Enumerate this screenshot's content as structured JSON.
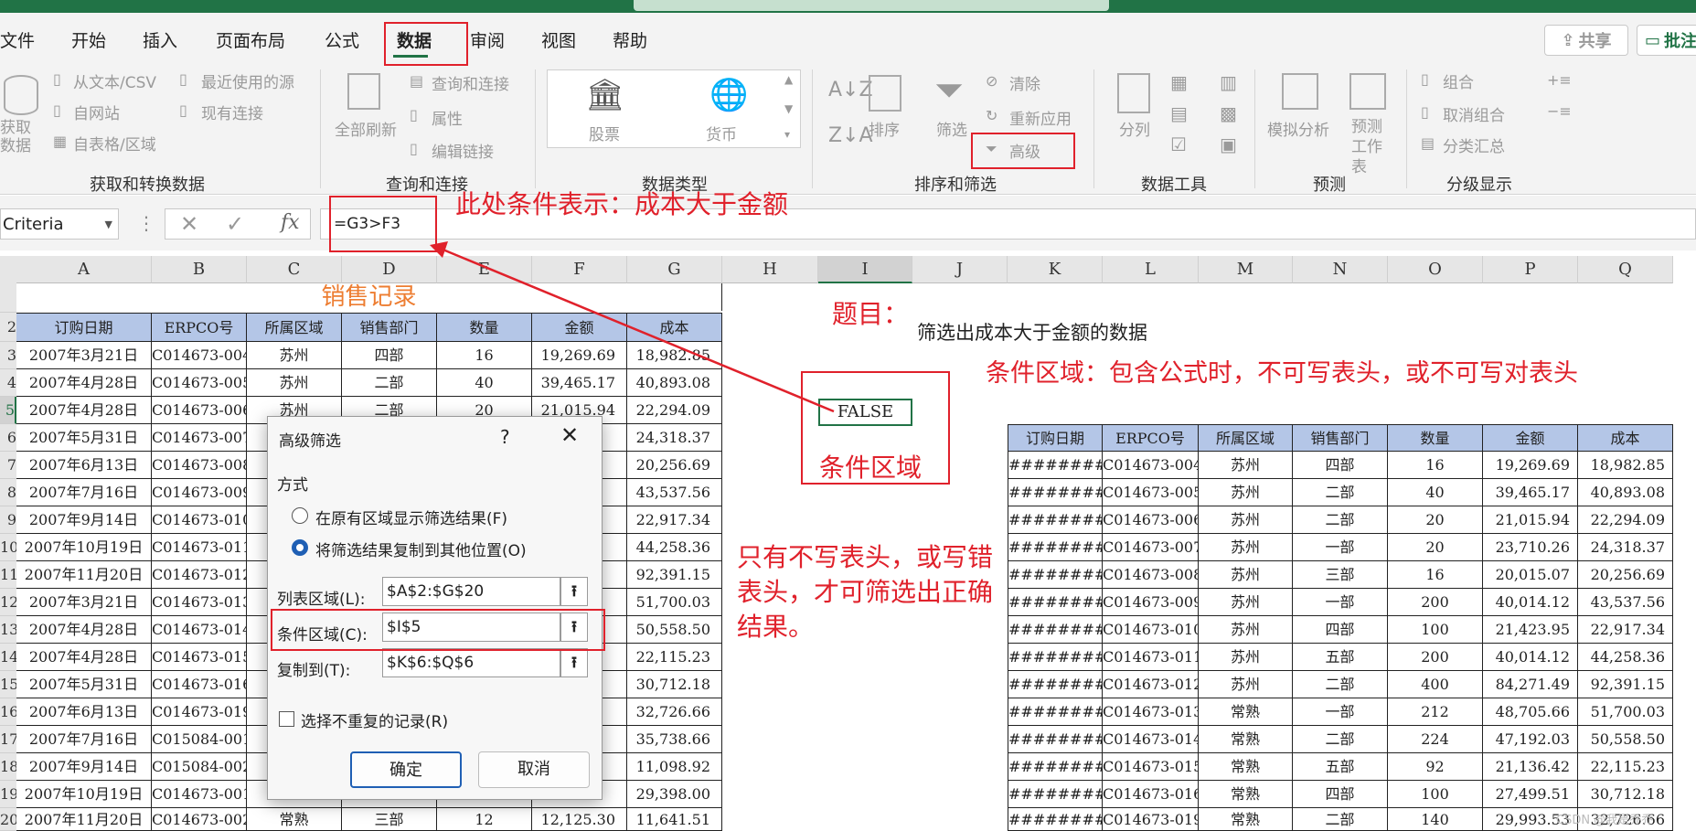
{
  "tabs": [
    "文件",
    "开始",
    "插入",
    "页面布局",
    "公式",
    "数据",
    "审阅",
    "视图",
    "帮助"
  ],
  "top_right": {
    "share": "共享",
    "comment": "批注"
  },
  "ribbon": {
    "get_data": {
      "get_data_label": "获取数据",
      "from_text": "从文本/CSV",
      "from_web": "自网站",
      "from_table": "自表格/区域",
      "recent": "最近使用的源",
      "existing": "现有连接",
      "group": "获取和转换数据"
    },
    "queries": {
      "refresh_all": "全部刷新",
      "queries_conn": "查询和连接",
      "properties": "属性",
      "edit_links": "编辑链接",
      "group": "查询和连接"
    },
    "data_types": {
      "stocks": "股票",
      "currency": "货币",
      "group": "数据类型"
    },
    "sort_filter": {
      "sort": "排序",
      "filter": "筛选",
      "clear": "清除",
      "reapply": "重新应用",
      "advanced": "高级",
      "group": "排序和筛选"
    },
    "data_tools": {
      "split": "分列",
      "group": "数据工具"
    },
    "forecast": {
      "whatif": "模拟分析",
      "sheet": "预测工作表",
      "group": "预测"
    },
    "outline": {
      "group_btn": "组合",
      "ungroup": "取消组合",
      "subtotal": "分类汇总",
      "group": "分级显示"
    }
  },
  "formula_bar": {
    "name_box": "Criteria",
    "fx": "fx",
    "formula": "=G3>F3"
  },
  "columns": [
    "A",
    "B",
    "C",
    "D",
    "E",
    "F",
    "G",
    "H",
    "I",
    "J",
    "K",
    "L",
    "M",
    "N",
    "O",
    "P",
    "Q"
  ],
  "row_numbers": [
    "",
    "2",
    "3",
    "4",
    "5",
    "6",
    "7",
    "8",
    "9",
    "10",
    "11",
    "12",
    "13",
    "14",
    "15",
    "16",
    "17",
    "18",
    "19",
    "20"
  ],
  "sales": {
    "title": "销售记录",
    "headers": [
      "订购日期",
      "ERPCO号",
      "所属区域",
      "销售部门",
      "数量",
      "金额",
      "成本"
    ],
    "rows": [
      [
        "2007年3月21日",
        "C014673-004",
        "苏州",
        "四部",
        "16",
        "19,269.69",
        "18,982.85"
      ],
      [
        "2007年4月28日",
        "C014673-005",
        "苏州",
        "二部",
        "40",
        "39,465.17",
        "40,893.08"
      ],
      [
        "2007年4月28日",
        "C014673-006",
        "苏州",
        "二部",
        "20",
        "21,015.94",
        "22,294.09"
      ],
      [
        "2007年5月31日",
        "C014673-007",
        "",
        "",
        "",
        "",
        "24,318.37"
      ],
      [
        "2007年6月13日",
        "C014673-008",
        "",
        "",
        "",
        "",
        "20,256.69"
      ],
      [
        "2007年7月16日",
        "C014673-009",
        "",
        "",
        "",
        "",
        "43,537.56"
      ],
      [
        "2007年9月14日",
        "C014673-010",
        "",
        "",
        "",
        "",
        "22,917.34"
      ],
      [
        "2007年10月19日",
        "C014673-011",
        "",
        "",
        "",
        "",
        "44,258.36"
      ],
      [
        "2007年11月20日",
        "C014673-012",
        "",
        "",
        "",
        "",
        "92,391.15"
      ],
      [
        "2007年3月21日",
        "C014673-013",
        "",
        "",
        "",
        "",
        "51,700.03"
      ],
      [
        "2007年4月28日",
        "C014673-014",
        "",
        "",
        "",
        "",
        "50,558.50"
      ],
      [
        "2007年4月28日",
        "C014673-015",
        "",
        "",
        "",
        "",
        "22,115.23"
      ],
      [
        "2007年5月31日",
        "C014673-016",
        "",
        "",
        "",
        "",
        "30,712.18"
      ],
      [
        "2007年6月13日",
        "C014673-019",
        "",
        "",
        "",
        "",
        "32,726.66"
      ],
      [
        "2007年7月16日",
        "C015084-001",
        "",
        "",
        "",
        "",
        "35,738.66"
      ],
      [
        "2007年9月14日",
        "C015084-002",
        "",
        "",
        "",
        "",
        "11,098.92"
      ],
      [
        "2007年10月19日",
        "C014673-001",
        "",
        "",
        "",
        "",
        "29,398.00"
      ],
      [
        "2007年11月20日",
        "C014673-002",
        "常熟",
        "三部",
        "12",
        "12,125.30",
        "11,641.51"
      ]
    ]
  },
  "result": {
    "headers": [
      "订购日期",
      "ERPCO号",
      "所属区域",
      "销售部门",
      "数量",
      "金额",
      "成本"
    ],
    "rows": [
      [
        "##########",
        "C014673-004",
        "苏州",
        "四部",
        "16",
        "19,269.69",
        "18,982.85"
      ],
      [
        "##########",
        "C014673-005",
        "苏州",
        "二部",
        "40",
        "39,465.17",
        "40,893.08"
      ],
      [
        "##########",
        "C014673-006",
        "苏州",
        "二部",
        "20",
        "21,015.94",
        "22,294.09"
      ],
      [
        "##########",
        "C014673-007",
        "苏州",
        "一部",
        "20",
        "23,710.26",
        "24,318.37"
      ],
      [
        "##########",
        "C014673-008",
        "苏州",
        "三部",
        "16",
        "20,015.07",
        "20,256.69"
      ],
      [
        "##########",
        "C014673-009",
        "苏州",
        "一部",
        "200",
        "40,014.12",
        "43,537.56"
      ],
      [
        "##########",
        "C014673-010",
        "苏州",
        "四部",
        "100",
        "21,423.95",
        "22,917.34"
      ],
      [
        "##########",
        "C014673-011",
        "苏州",
        "五部",
        "200",
        "40,014.12",
        "44,258.36"
      ],
      [
        "##########",
        "C014673-012",
        "苏州",
        "二部",
        "400",
        "84,271.49",
        "92,391.15"
      ],
      [
        "##########",
        "C014673-013",
        "常熟",
        "一部",
        "212",
        "48,705.66",
        "51,700.03"
      ],
      [
        "##########",
        "C014673-014",
        "常熟",
        "二部",
        "224",
        "47,192.03",
        "50,558.50"
      ],
      [
        "##########",
        "C014673-015",
        "常熟",
        "五部",
        "92",
        "21,136.42",
        "22,115.23"
      ],
      [
        "##########",
        "C014673-016",
        "常熟",
        "四部",
        "100",
        "27,499.51",
        "30,712.18"
      ],
      [
        "##########",
        "C014673-019",
        "常熟",
        "二部",
        "140",
        "29,993.53",
        "32,726.66"
      ]
    ]
  },
  "criteria_value": "FALSE",
  "annotations": {
    "formula_note": "此处条件表示：成本大于金额",
    "topic_label": "题目：",
    "topic_text": "筛选出成本大于金额的数据",
    "criteria_note": "条件区域：包含公式时，不可写表头，或不可写对表头",
    "criteria_area": "条件区域",
    "header_note_1": "只有不写表头，或写错",
    "header_note_2": "表头，才可筛选出正确",
    "header_note_3": "结果。"
  },
  "dialog": {
    "title": "高级筛选",
    "help": "?",
    "mode_label": "方式",
    "option1": "在原有区域显示筛选结果(F)",
    "option2": "将筛选结果复制到其他位置(O)",
    "list_label": "列表区域(L):",
    "list_value": "$A$2:$G$20",
    "criteria_label": "条件区域(C):",
    "criteria_value": "$I$5",
    "copy_label": "复制到(T):",
    "copy_value": "$K$6:$Q$6",
    "unique_label": "选择不重复的记录(R)",
    "ok": "确定",
    "cancel": "取消"
  },
  "watermark": "CSDN @我是乔乔",
  "colors": {
    "accent": "#217346",
    "annotation": "#e0212b",
    "header_fill": "#b4c6e7",
    "title_orange": "#ed7d31"
  }
}
